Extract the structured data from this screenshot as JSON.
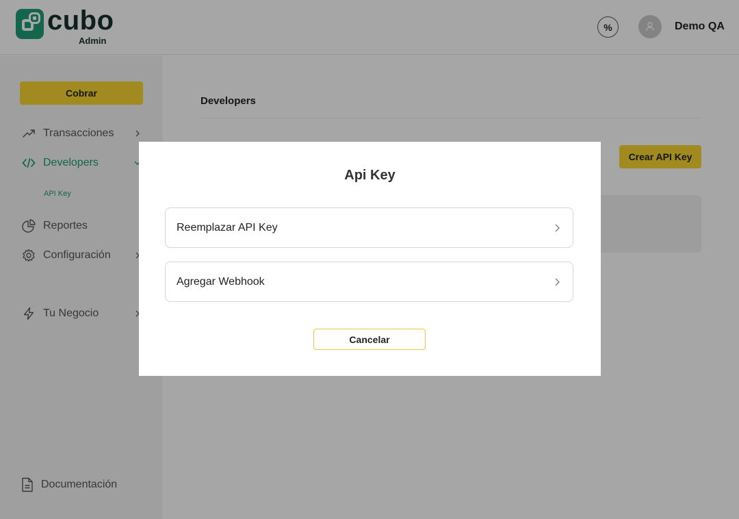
{
  "header": {
    "logo_text": "cubo",
    "logo_sub": "Admin",
    "discount_symbol": "%",
    "user_name": "Demo QA"
  },
  "sidebar": {
    "primary_button": "Cobrar",
    "items": [
      {
        "label": "Transacciones",
        "icon": "trend-up-icon",
        "chevron": "right"
      },
      {
        "label": "Developers",
        "icon": "code-icon",
        "chevron": "down",
        "active": true
      },
      {
        "label": "Reportes",
        "icon": "pie-chart-icon",
        "chevron": "none"
      },
      {
        "label": "Configuración",
        "icon": "gear-icon",
        "chevron": "right"
      },
      {
        "label": "Tu Negocio",
        "icon": "lightning-icon",
        "chevron": "right"
      }
    ],
    "subitem": "API Key",
    "footer_item": "Documentación"
  },
  "main": {
    "title": "Developers",
    "create_button": "Crear API Key"
  },
  "modal": {
    "title": "Api Key",
    "options": [
      {
        "label": "Reemplazar API Key"
      },
      {
        "label": "Agregar Webhook"
      }
    ],
    "cancel_button": "Cancelar"
  },
  "colors": {
    "brand_green": "#1e9b74",
    "accent_yellow": "#f7d633",
    "overlay": "rgba(0,0,0,0.35)"
  }
}
